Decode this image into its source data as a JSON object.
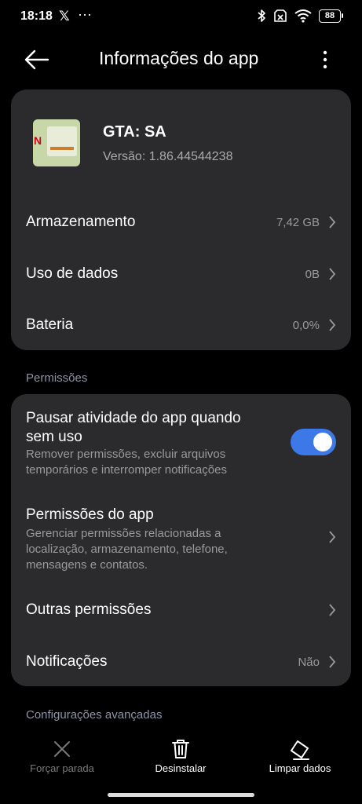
{
  "status": {
    "time": "18:18",
    "x_app_icon": "x-logo-icon",
    "more_notifications": "···",
    "battery": "88"
  },
  "app_bar": {
    "title": "Informações do app"
  },
  "app": {
    "name": "GTA: SA",
    "version": "Versão: 1.86.44544238",
    "icon_brand_letter": "N"
  },
  "summary_rows": [
    {
      "label": "Armazenamento",
      "value": "7,42 GB"
    },
    {
      "label": "Uso de dados",
      "value": "0B"
    },
    {
      "label": "Bateria",
      "value": "0,0%"
    }
  ],
  "permissions_section": {
    "title": "Permissões",
    "pause": {
      "label": "Pausar atividade do app quando sem uso",
      "label_line1": "Pausar atividade do app quando",
      "label_line2": "sem uso",
      "desc_line1": "Remover permissões, excluir arquivos",
      "desc_line2": "temporários e interromper notificações",
      "enabled": true
    },
    "app_permissions": {
      "label": "Permissões do app",
      "desc_line1": "Gerenciar permissões relacionadas a",
      "desc_line2": "localização, armazenamento, telefone,",
      "desc_line3": "mensagens e contatos."
    },
    "other": {
      "label": "Outras permissões"
    },
    "notifications": {
      "label": "Notificações",
      "value": "Não"
    }
  },
  "advanced_section": {
    "title": "Configurações avançadas"
  },
  "bottom_actions": {
    "force_stop": "Forçar parada",
    "uninstall": "Desinstalar",
    "clear_data": "Limpar dados"
  },
  "colors": {
    "background": "#000000",
    "card": "#2b2b2d",
    "toggle_on": "#3d78e8",
    "section_title": "#8e93a6",
    "secondary_text": "#9a9a9a",
    "disabled_text": "#7a7a7a"
  }
}
